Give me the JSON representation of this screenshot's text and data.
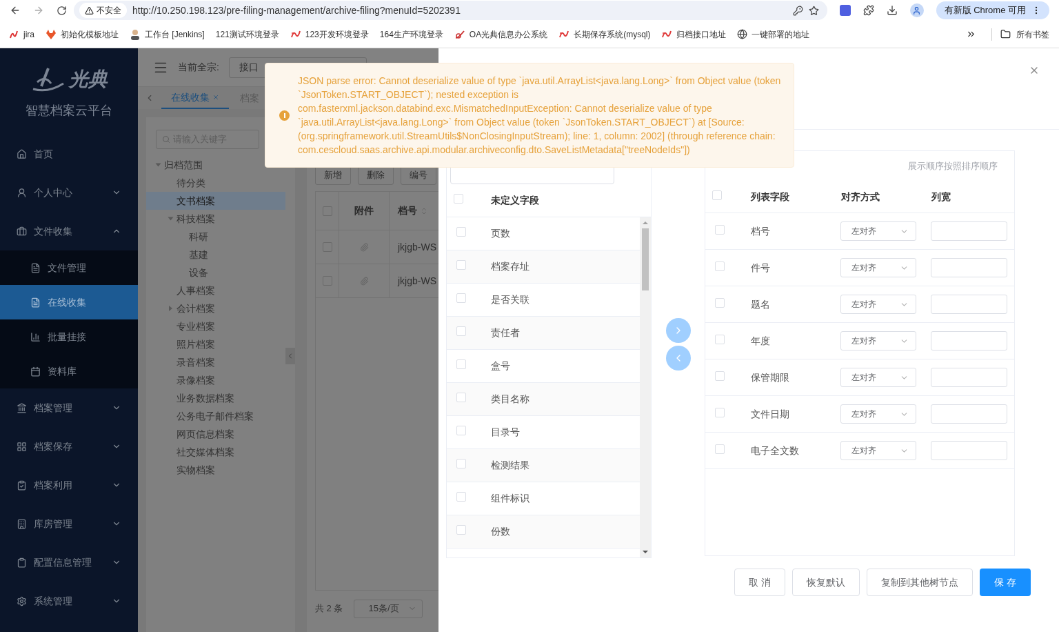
{
  "browser": {
    "security_label": "不安全",
    "url": "http://10.250.198.123/pre-filing-management/archive-filing?menuId=5202391",
    "update_button": "有新版 Chrome 可用",
    "all_bookmarks": "所有书签",
    "bookmarks": [
      {
        "label": "jira",
        "kind": "jira"
      },
      {
        "label": "初始化模板地址",
        "kind": "fox"
      },
      {
        "label": "工作台 [Jenkins]",
        "kind": "person"
      },
      {
        "label": "121测试环境登录",
        "kind": "none"
      },
      {
        "label": "123开发环境登录",
        "kind": "swirl"
      },
      {
        "label": "164生产环境登录",
        "kind": "none"
      },
      {
        "label": "OA光典信息办公系统",
        "kind": "oa"
      },
      {
        "label": "长期保存系统(mysql)",
        "kind": "swirl"
      },
      {
        "label": "归档接口地址",
        "kind": "swirl"
      },
      {
        "label": "一键部署的地址",
        "kind": "globe"
      }
    ]
  },
  "sidebar": {
    "logo_text": "光典",
    "platform": "智慧档案云平台",
    "items": [
      {
        "label": "首页",
        "kind": "link"
      },
      {
        "label": "个人中心",
        "kind": "group",
        "expanded": false
      },
      {
        "label": "文件收集",
        "kind": "group",
        "expanded": true,
        "children": [
          {
            "label": "文件管理",
            "selected": false
          },
          {
            "label": "在线收集",
            "selected": true
          },
          {
            "label": "批量挂接",
            "selected": false
          },
          {
            "label": "资料库",
            "selected": false
          }
        ]
      },
      {
        "label": "档案管理",
        "kind": "group",
        "expanded": false
      },
      {
        "label": "档案保存",
        "kind": "group",
        "expanded": false
      },
      {
        "label": "档案利用",
        "kind": "group",
        "expanded": false
      },
      {
        "label": "库房管理",
        "kind": "group",
        "expanded": false
      },
      {
        "label": "配置信息管理",
        "kind": "group",
        "expanded": false
      },
      {
        "label": "系统管理",
        "kind": "group",
        "expanded": false
      }
    ]
  },
  "header": {
    "fonds_label": "当前全宗:",
    "fonds_value": "接口"
  },
  "tabs": [
    {
      "label": "在线收集",
      "selected": true,
      "closable": true
    },
    {
      "label": "档案",
      "selected": false,
      "closable": false
    }
  ],
  "tree": {
    "search_placeholder": "请输入关键字",
    "nodes": [
      {
        "label": "归档范围",
        "expanded": true,
        "selected": false,
        "children": [
          {
            "label": "待分类",
            "selected": false
          },
          {
            "label": "文书档案",
            "selected": true
          },
          {
            "label": "科技档案",
            "expanded": true,
            "selected": false,
            "children": [
              {
                "label": "科研",
                "selected": false
              },
              {
                "label": "基建",
                "selected": false
              },
              {
                "label": "设备",
                "selected": false
              }
            ]
          },
          {
            "label": "人事档案",
            "selected": false
          },
          {
            "label": "会计档案",
            "expanded": false,
            "selected": false
          },
          {
            "label": "专业档案",
            "selected": false
          },
          {
            "label": "照片档案",
            "selected": false
          },
          {
            "label": "录音档案",
            "selected": false
          },
          {
            "label": "录像档案",
            "selected": false
          },
          {
            "label": "业务数据档案",
            "selected": false
          },
          {
            "label": "公务电子邮件档案",
            "selected": false
          },
          {
            "label": "网页信息档案",
            "selected": false
          },
          {
            "label": "社交媒体档案",
            "selected": false
          },
          {
            "label": "实物档案",
            "selected": false
          }
        ]
      }
    ]
  },
  "table": {
    "header_checked": false,
    "buttons": [
      "新增",
      "删除",
      "编号"
    ],
    "columns": [
      "附件",
      "档号"
    ],
    "rows": [
      {
        "checked": false,
        "archive_no": "jkjgb-WS"
      },
      {
        "checked": false,
        "archive_no": "jkjgb-WS"
      }
    ],
    "total": "共 2 条",
    "page_size": "15条/页"
  },
  "toast": {
    "message": "JSON parse error: Cannot deserialize value of type `java.util.ArrayList<java.lang.Long>` from Object value (token `JsonToken.START_OBJECT`); nested exception is com.fasterxml.jackson.databind.exc.MismatchedInputException: Cannot deserialize value of type `java.util.ArrayList<java.lang.Long>` from Object value (token `JsonToken.START_OBJECT`) at [Source: (org.springframework.util.StreamUtils$NonClosingInputStream); line: 1, column: 2002] (through reference chain: com.cescloud.saas.archive.api.modular.archiveconfig.dto.SaveListMetadata[\"treeNodeIds\"])"
  },
  "drawer": {
    "undefined_fields": {
      "header": "未定义字段",
      "header_checked": false,
      "rows": [
        {
          "label": "页数",
          "checked": false
        },
        {
          "label": "档案存址",
          "checked": false
        },
        {
          "label": "是否关联",
          "checked": false
        },
        {
          "label": "责任者",
          "checked": false
        },
        {
          "label": "盒号",
          "checked": false
        },
        {
          "label": "类目名称",
          "checked": false
        },
        {
          "label": "目录号",
          "checked": false
        },
        {
          "label": "检测结果",
          "checked": false
        },
        {
          "label": "组件标识",
          "checked": false
        },
        {
          "label": "份数",
          "checked": false
        }
      ]
    },
    "list_fields": {
      "hint": "展示顺序按照排序顺序",
      "header_checked": false,
      "columns": [
        "列表字段",
        "对齐方式",
        "列宽"
      ],
      "rows": [
        {
          "label": "档号",
          "align": "左对齐",
          "checked": false
        },
        {
          "label": "件号",
          "align": "左对齐",
          "checked": false
        },
        {
          "label": "题名",
          "align": "左对齐",
          "checked": false
        },
        {
          "label": "年度",
          "align": "左对齐",
          "checked": false
        },
        {
          "label": "保管期限",
          "align": "左对齐",
          "checked": false
        },
        {
          "label": "文件日期",
          "align": "左对齐",
          "checked": false
        },
        {
          "label": "电子全文数",
          "align": "左对齐",
          "checked": false
        }
      ]
    },
    "buttons": [
      {
        "label": "取 消",
        "kind": "default"
      },
      {
        "label": "恢复默认",
        "kind": "default"
      },
      {
        "label": "复制到其他树节点",
        "kind": "default"
      },
      {
        "label": "保 存",
        "kind": "primary"
      }
    ]
  }
}
